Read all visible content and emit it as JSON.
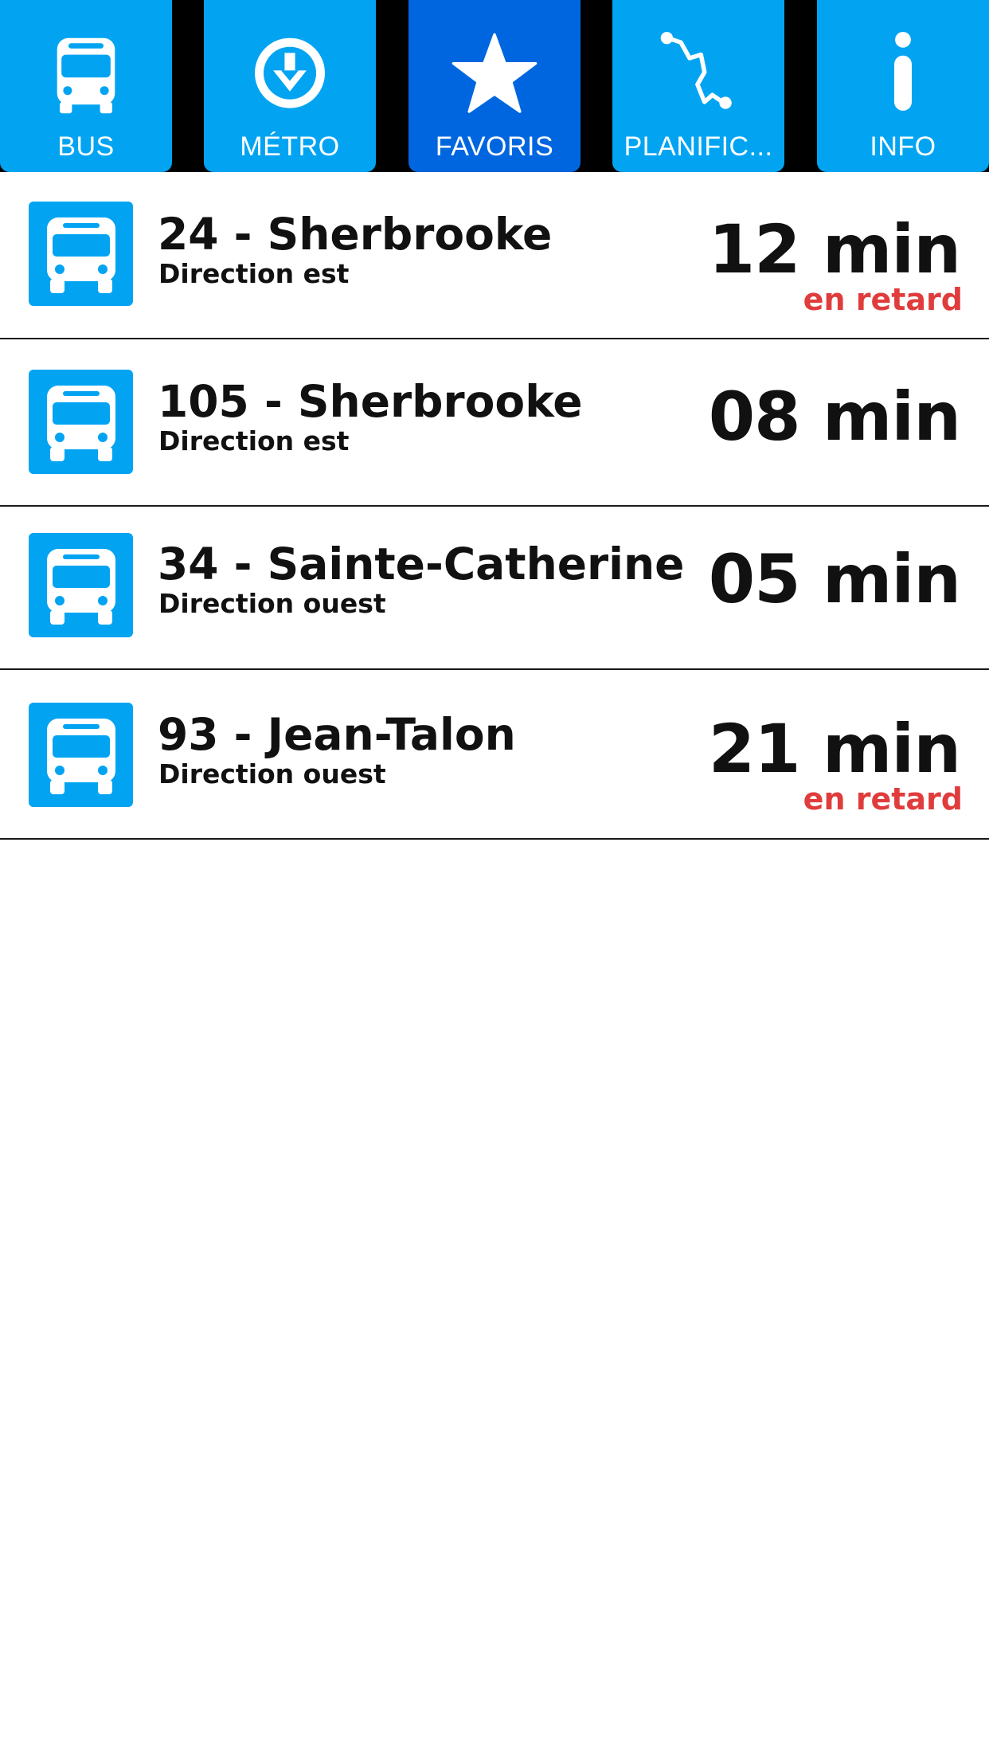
{
  "tabs": [
    {
      "label": "BUS",
      "icon": "bus-icon",
      "active": false
    },
    {
      "label": "MÉTRO",
      "icon": "metro-icon",
      "active": false
    },
    {
      "label": "FAVORIS",
      "icon": "star-icon",
      "active": true
    },
    {
      "label": "PLANIFIC...",
      "icon": "route-planner-icon",
      "active": false
    },
    {
      "label": "INFO",
      "icon": "info-icon",
      "active": false
    }
  ],
  "favorites": [
    {
      "route": "24 - Sherbrooke",
      "direction": "Direction est",
      "time": "12 min",
      "status": "en retard"
    },
    {
      "route": "105 - Sherbrooke",
      "direction": "Direction est",
      "time": "08 min",
      "status": ""
    },
    {
      "route": "34 - Sainte-Catherine",
      "direction": "Direction ouest",
      "time": "05 min",
      "status": ""
    },
    {
      "route": "93 - Jean-Talon",
      "direction": "Direction ouest",
      "time": "21 min",
      "status": "en retard"
    }
  ],
  "colors": {
    "tab_bg": "#02a4f2",
    "tab_active_bg": "#0066df",
    "late_status": "#e03c3c",
    "bus_icon_bg": "#02a4f2"
  }
}
